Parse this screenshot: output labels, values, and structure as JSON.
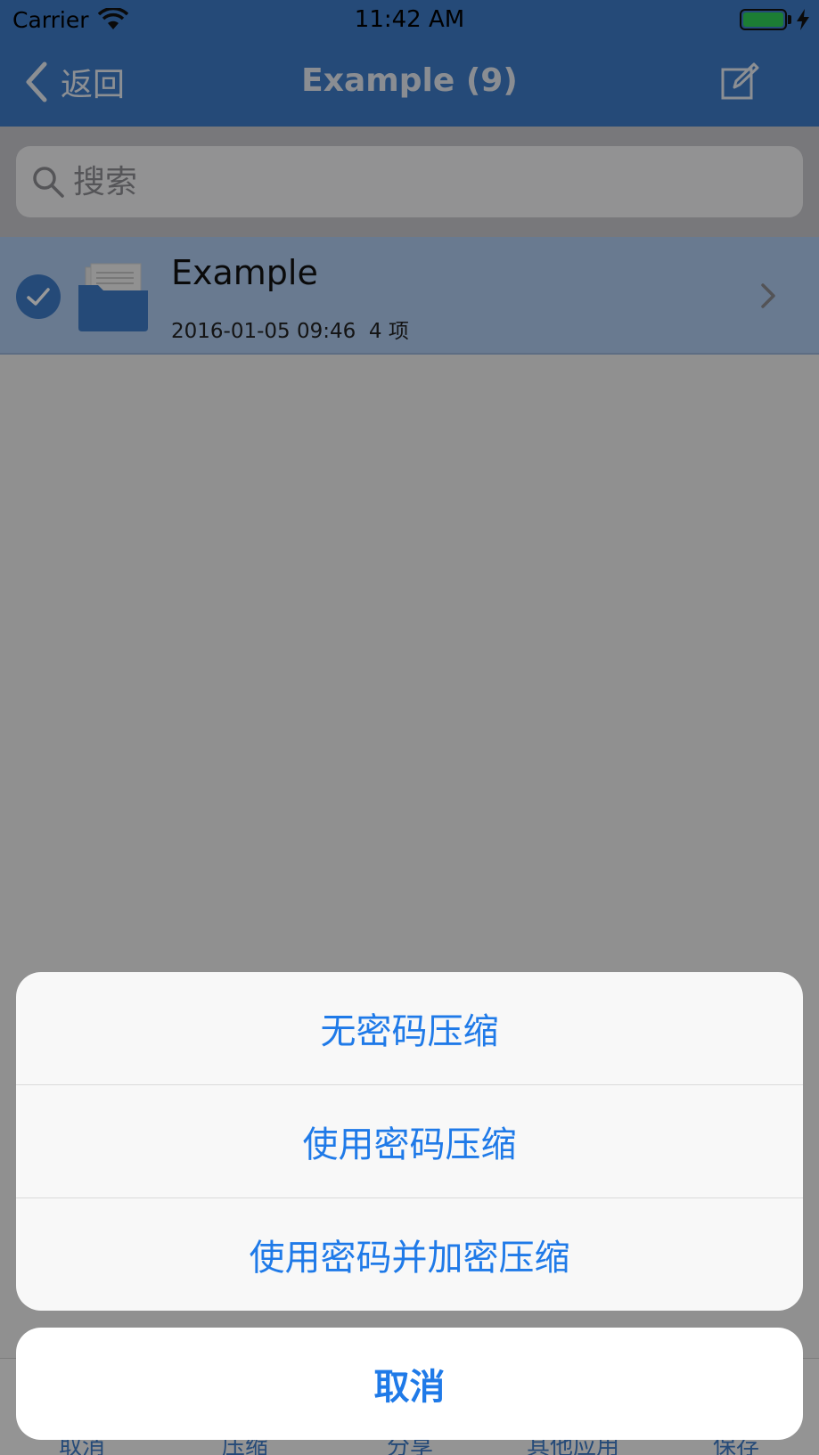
{
  "status_bar": {
    "carrier": "Carrier",
    "time": "11:42 AM"
  },
  "nav": {
    "back_label": "返回",
    "title": "Example (9)"
  },
  "search": {
    "placeholder": "搜索"
  },
  "file_list": {
    "items": [
      {
        "name": "Example",
        "date": "2016-01-05 09:46",
        "count": "4 项",
        "selected": true
      }
    ]
  },
  "toolbar": {
    "items": [
      "取消",
      "压缩",
      "分享",
      "其他应用",
      "保存"
    ]
  },
  "action_sheet": {
    "options": [
      "无密码压缩",
      "使用密码压缩",
      "使用密码并加密压缩"
    ],
    "cancel": "取消"
  },
  "colors": {
    "accent": "#3f7cc9",
    "action_text": "#1f7ae8"
  }
}
